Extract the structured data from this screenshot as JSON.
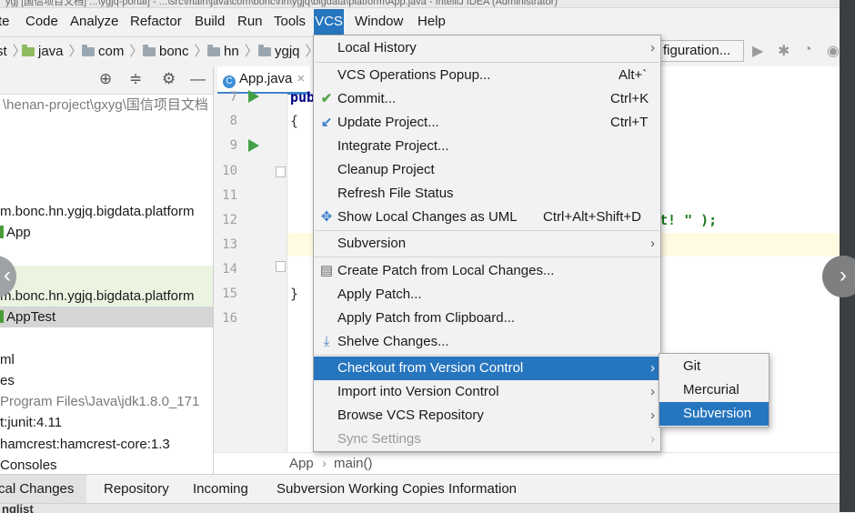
{
  "title_text": "ygj [国信项目文档] ...\\ygjq-portal] - ...\\src\\main\\java\\com\\bonc\\hn\\ygjq\\bigdata\\platform\\App.java - IntelliJ IDEA (Administrator)",
  "menubar": [
    "te",
    "Code",
    "Analyze",
    "Refactor",
    "Build",
    "Run",
    "Tools",
    "VCS",
    "Window",
    "Help"
  ],
  "navbar": [
    "st",
    "java",
    "com",
    "bonc",
    "hn",
    "ygjq"
  ],
  "toolbar": {
    "run_config": "figuration..."
  },
  "project_tree": [
    "\\henan-project\\gxyg\\国信项目文档",
    "m.bonc.hn.ygjq.bigdata.platform",
    "App",
    "m.bonc.hn.ygjq.bigdata.platform",
    "AppTest",
    "ml",
    "es",
    "Program Files\\Java\\jdk1.8.0_171",
    "t:junit:4.11",
    "hamcrest:hamcrest-core:1.3",
    "Consoles"
  ],
  "editor": {
    "tab": "App.java",
    "line_numbers": [
      "7",
      "8",
      "9",
      "10",
      "11",
      "12",
      "13",
      "14",
      "15",
      "16"
    ],
    "code": {
      "l7": "pub",
      "l8": "{",
      "l12": "t! \" );",
      "l15": "}"
    },
    "breadcrumb": [
      "App",
      "main()"
    ]
  },
  "vcs_menu": {
    "items": [
      {
        "label": "Local History",
        "shortcut": "",
        "submenu": true,
        "icon": ""
      },
      {
        "label": "VCS Operations Popup...",
        "shortcut": "Alt+`",
        "submenu": false,
        "icon": ""
      },
      {
        "label": "Commit...",
        "shortcut": "Ctrl+K",
        "submenu": false,
        "icon": "check-icon"
      },
      {
        "label": "Update Project...",
        "shortcut": "Ctrl+T",
        "submenu": false,
        "icon": "update-icon"
      },
      {
        "label": "Integrate Project...",
        "shortcut": "",
        "submenu": false,
        "icon": ""
      },
      {
        "label": "Cleanup Project",
        "shortcut": "",
        "submenu": false,
        "icon": ""
      },
      {
        "label": "Refresh File Status",
        "shortcut": "",
        "submenu": false,
        "icon": ""
      },
      {
        "label": "Show Local Changes as UML",
        "shortcut": "Ctrl+Alt+Shift+D",
        "submenu": false,
        "icon": "uml-icon"
      },
      {
        "label": "Subversion",
        "shortcut": "",
        "submenu": true,
        "icon": ""
      },
      {
        "label": "Create Patch from Local Changes...",
        "shortcut": "",
        "submenu": false,
        "icon": "patch-icon"
      },
      {
        "label": "Apply Patch...",
        "shortcut": "",
        "submenu": false,
        "icon": ""
      },
      {
        "label": "Apply Patch from Clipboard...",
        "shortcut": "",
        "submenu": false,
        "icon": ""
      },
      {
        "label": "Shelve Changes...",
        "shortcut": "",
        "submenu": false,
        "icon": "shelve-icon"
      },
      {
        "label": "Checkout from Version Control",
        "shortcut": "",
        "submenu": true,
        "icon": "",
        "active": true
      },
      {
        "label": "Import into Version Control",
        "shortcut": "",
        "submenu": true,
        "icon": ""
      },
      {
        "label": "Browse VCS Repository",
        "shortcut": "",
        "submenu": true,
        "icon": ""
      },
      {
        "label": "Sync Settings",
        "shortcut": "",
        "submenu": true,
        "icon": "",
        "disabled": true
      }
    ]
  },
  "checkout_submenu": [
    "Git",
    "Mercurial",
    "Subversion"
  ],
  "bottom_tabs": [
    "cal Changes",
    "Repository",
    "Incoming",
    "Subversion Working Copies Information"
  ],
  "bottom_strip": "nglist",
  "colors": {
    "accent": "#2675bf",
    "run_green": "#43a047",
    "current_line": "#fffbe2"
  }
}
